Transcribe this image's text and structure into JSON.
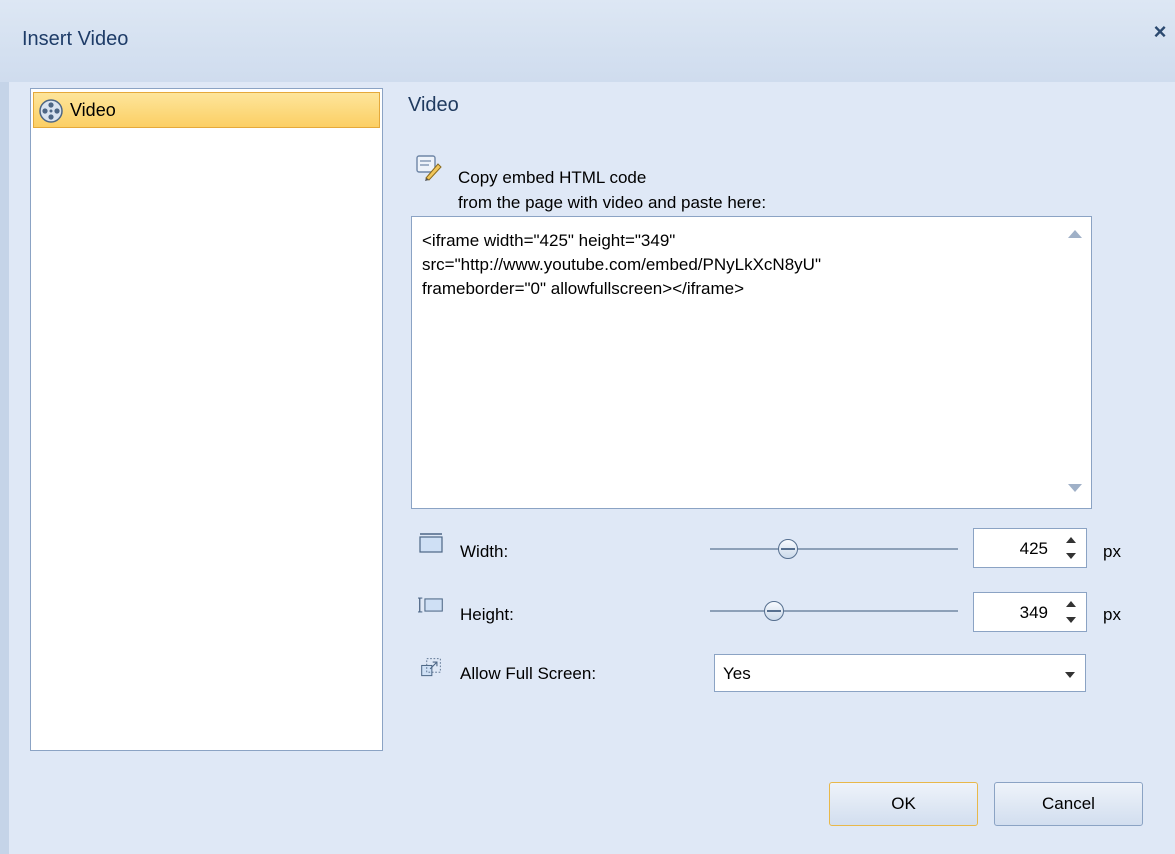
{
  "window": {
    "title": "Insert Video",
    "close_glyph": "×"
  },
  "tree": {
    "items": [
      {
        "label": "Video",
        "icon": "film-reel-icon",
        "selected": true
      }
    ]
  },
  "section": {
    "title": "Video"
  },
  "embed": {
    "instruction_line1": "Copy embed HTML code",
    "instruction_line2": "from the page with video and paste here:",
    "code": "<iframe width=\"425\" height=\"349\"\nsrc=\"http://www.youtube.com/embed/PNyLkXcN8yU\"\nframeborder=\"0\" allowfullscreen></iframe>"
  },
  "fields": {
    "width": {
      "label": "Width:",
      "value": "425",
      "unit": "px"
    },
    "height": {
      "label": "Height:",
      "value": "349",
      "unit": "px"
    },
    "fullscreen": {
      "label": "Allow Full Screen:",
      "value": "Yes"
    }
  },
  "buttons": {
    "ok": "OK",
    "cancel": "Cancel"
  },
  "colors": {
    "dialog_bg": "#dfe8f6",
    "selection": "#fcd56f",
    "title_text": "#1e3c68"
  }
}
